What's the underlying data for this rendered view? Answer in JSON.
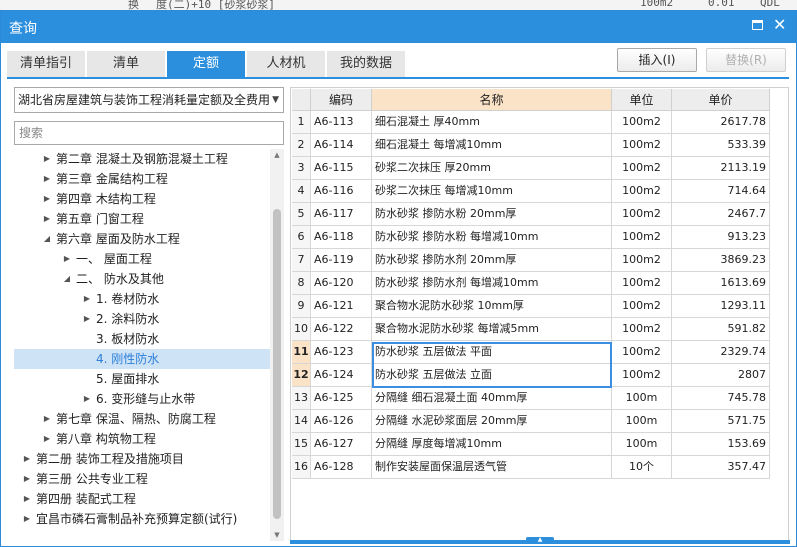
{
  "background": {
    "fragments": [
      "换",
      "度(二)+10 [砂浆砂浆]",
      "100m2",
      "0.01",
      "QDL"
    ]
  },
  "window": {
    "title": "查询",
    "accent_color": "#2b8fde"
  },
  "tabs": [
    "清单指引",
    "清单",
    "定额",
    "人材机",
    "我的数据"
  ],
  "active_tab": "定额",
  "buttons": {
    "insert": "插入(I)",
    "replace": "替换(R)"
  },
  "left": {
    "select_value": "湖北省房屋建筑与装饰工程消耗量定额及全费用",
    "search_placeholder": "搜索",
    "tree": [
      {
        "label": "第二章 混凝土及钢筋混凝土工程",
        "level": 1,
        "caret": "right"
      },
      {
        "label": "第三章 金属结构工程",
        "level": 1,
        "caret": "right"
      },
      {
        "label": "第四章 木结构工程",
        "level": 1,
        "caret": "right"
      },
      {
        "label": "第五章 门窗工程",
        "level": 1,
        "caret": "right"
      },
      {
        "label": "第六章 屋面及防水工程",
        "level": 1,
        "caret": "down"
      },
      {
        "label": "一、 屋面工程",
        "level": 2,
        "caret": "right"
      },
      {
        "label": "二、 防水及其他",
        "level": 2,
        "caret": "down"
      },
      {
        "label": "1. 卷材防水",
        "level": 3,
        "caret": "right"
      },
      {
        "label": "2. 涂料防水",
        "level": 3,
        "caret": "right"
      },
      {
        "label": "3. 板材防水",
        "level": 3,
        "caret": ""
      },
      {
        "label": "4. 刚性防水",
        "level": 3,
        "caret": "",
        "selected": true
      },
      {
        "label": "5. 屋面排水",
        "level": 3,
        "caret": ""
      },
      {
        "label": "6. 变形缝与止水带",
        "level": 3,
        "caret": "right"
      },
      {
        "label": "第七章 保温、隔热、防腐工程",
        "level": 1,
        "caret": "right"
      },
      {
        "label": "第八章 构筑物工程",
        "level": 1,
        "caret": "right"
      },
      {
        "label": "第二册 装饰工程及措施项目",
        "level": 0,
        "caret": "right"
      },
      {
        "label": "第三册 公共专业工程",
        "level": 0,
        "caret": "right"
      },
      {
        "label": "第四册 装配式工程",
        "level": 0,
        "caret": "right"
      },
      {
        "label": "宜昌市磷石膏制品补充预算定额(试行)",
        "level": 0,
        "caret": "right"
      }
    ]
  },
  "grid": {
    "headers": [
      "",
      "编码",
      "名称",
      "单位",
      "单价"
    ],
    "rows": [
      {
        "num": "1",
        "code": "A6-113",
        "name": "细石混凝土 厚40mm",
        "unit": "100m2",
        "price": "2617.78"
      },
      {
        "num": "2",
        "code": "A6-114",
        "name": "细石混凝土 每增减10mm",
        "unit": "100m2",
        "price": "533.39"
      },
      {
        "num": "3",
        "code": "A6-115",
        "name": "砂浆二次抹压 厚20mm",
        "unit": "100m2",
        "price": "2113.19"
      },
      {
        "num": "4",
        "code": "A6-116",
        "name": "砂浆二次抹压 每增减10mm",
        "unit": "100m2",
        "price": "714.64"
      },
      {
        "num": "5",
        "code": "A6-117",
        "name": "防水砂浆 掺防水粉 20mm厚",
        "unit": "100m2",
        "price": "2467.7"
      },
      {
        "num": "6",
        "code": "A6-118",
        "name": "防水砂浆 掺防水粉 每增减10mm",
        "unit": "100m2",
        "price": "913.23"
      },
      {
        "num": "7",
        "code": "A6-119",
        "name": "防水砂浆 掺防水剂 20mm厚",
        "unit": "100m2",
        "price": "3869.23"
      },
      {
        "num": "8",
        "code": "A6-120",
        "name": "防水砂浆 掺防水剂 每增减10mm",
        "unit": "100m2",
        "price": "1613.69"
      },
      {
        "num": "9",
        "code": "A6-121",
        "name": "聚合物水泥防水砂浆 10mm厚",
        "unit": "100m2",
        "price": "1293.11"
      },
      {
        "num": "10",
        "code": "A6-122",
        "name": "聚合物水泥防水砂浆 每增减5mm",
        "unit": "100m2",
        "price": "591.82"
      },
      {
        "num": "11",
        "code": "A6-123",
        "name": "防水砂浆 五层做法 平面",
        "unit": "100m2",
        "price": "2329.74",
        "highlight": true
      },
      {
        "num": "12",
        "code": "A6-124",
        "name": "防水砂浆 五层做法 立面",
        "unit": "100m2",
        "price": "2807",
        "highlight": true
      },
      {
        "num": "13",
        "code": "A6-125",
        "name": "分隔缝 细石混凝土面 40mm厚",
        "unit": "100m",
        "price": "745.78"
      },
      {
        "num": "14",
        "code": "A6-126",
        "name": "分隔缝 水泥砂浆面层 20mm厚",
        "unit": "100m",
        "price": "571.75"
      },
      {
        "num": "15",
        "code": "A6-127",
        "name": "分隔缝 厚度每增减10mm",
        "unit": "100m",
        "price": "153.69"
      },
      {
        "num": "16",
        "code": "A6-128",
        "name": "制作安装屋面保温层透气管",
        "unit": "10个",
        "price": "357.47"
      }
    ]
  }
}
